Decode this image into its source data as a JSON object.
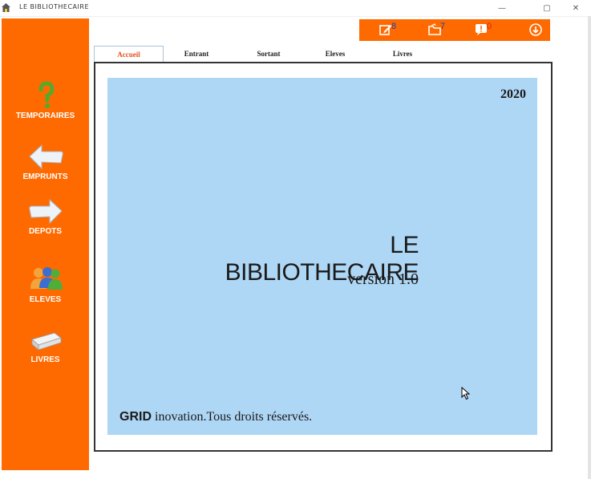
{
  "window": {
    "title": "LE BIBLIOTHECAIRE",
    "minimize_glyph": "—",
    "maximize_glyph": "▢",
    "close_glyph": "✕"
  },
  "sidebar": {
    "items": [
      {
        "label": "TEMPORAIRES",
        "icon": "question-mark-icon"
      },
      {
        "label": "EMPRUNTS",
        "icon": "arrow-left-icon"
      },
      {
        "label": "DEPOTS",
        "icon": "arrow-right-icon"
      },
      {
        "label": "ELEVES",
        "icon": "users-icon"
      },
      {
        "label": "LIVRES",
        "icon": "book-icon"
      }
    ]
  },
  "toolbar": {
    "items": [
      {
        "icon": "edit-icon",
        "count": "8",
        "count_color": "#1f3fa8"
      },
      {
        "icon": "folder-icon",
        "count": "7",
        "count_color": "#1f3fa8"
      },
      {
        "icon": "alert-icon",
        "count": "0",
        "count_color": "#d42020"
      },
      {
        "icon": "download-icon"
      }
    ]
  },
  "tabs": [
    {
      "label": "Accueil",
      "active": true
    },
    {
      "label": "Entrant",
      "active": false
    },
    {
      "label": "Sortant",
      "active": false
    },
    {
      "label": "Eleves",
      "active": false
    },
    {
      "label": "Livres",
      "active": false
    }
  ],
  "welcome": {
    "year": "2020",
    "app_name": "LE BIBLIOTHECAIRE",
    "version": "version 1.0",
    "footer_brand": "GRID",
    "footer_text": " inovation.Tous droits réservés."
  },
  "colors": {
    "accent": "#ff6a00",
    "hero_bg": "#aed6f5",
    "active_tab_text": "#e2501a"
  }
}
